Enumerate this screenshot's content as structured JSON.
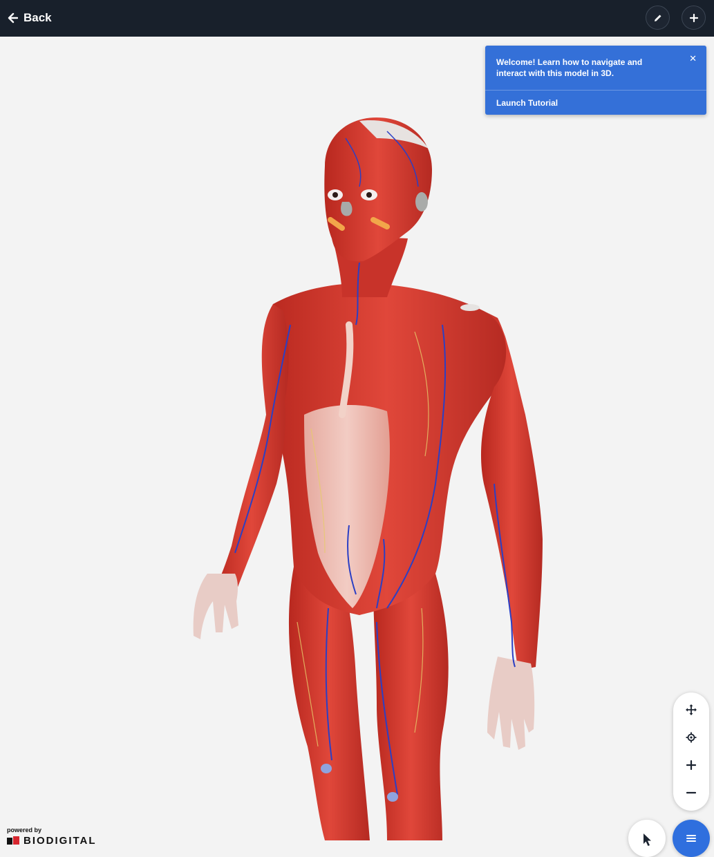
{
  "header": {
    "back_label": "Back",
    "icons": {
      "back": "arrow-left-icon",
      "edit": "pencil-icon",
      "add": "plus-icon"
    }
  },
  "toast": {
    "message": "Welcome! Learn how to navigate and interact with this model in 3D.",
    "close_glyph": "✕",
    "action_label": "Launch Tutorial",
    "color": "#3470d8"
  },
  "model": {
    "description_icon": "anatomy-3d-model",
    "colors": {
      "muscle": "#d23c34",
      "vein": "#2b3fc4",
      "bone": "#e7d7d3",
      "tendon": "#f0d0c6"
    }
  },
  "controls": {
    "icons": [
      "move-arrows-icon",
      "crosshair-icon",
      "zoom-in-icon",
      "zoom-out-icon"
    ],
    "cursor_icon": "pointer-cursor-icon",
    "menu_icon": "menu-icon",
    "accent": "#2f6fde"
  },
  "branding": {
    "powered_by": "powered by",
    "brand_name": "BIODIGITAL"
  }
}
